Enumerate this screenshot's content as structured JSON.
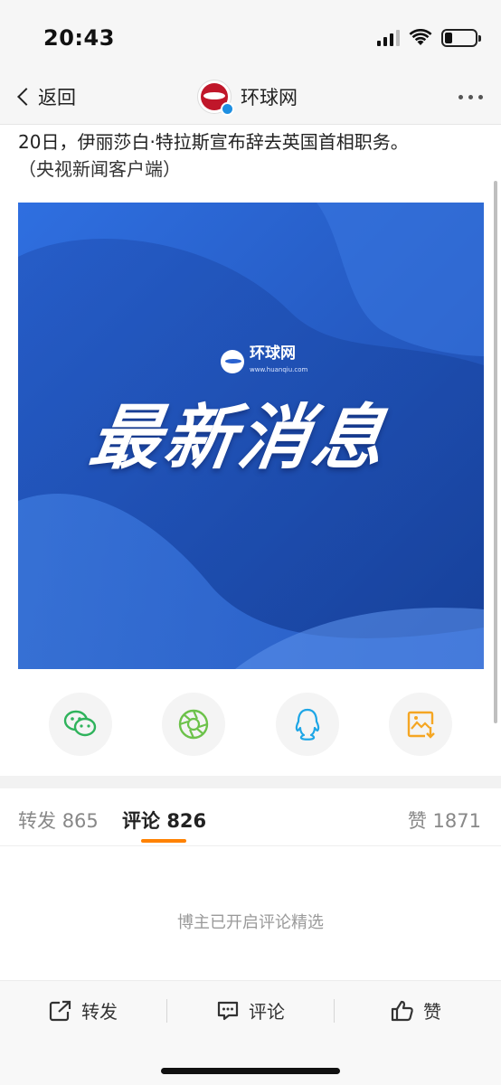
{
  "status_bar": {
    "time": "20:43",
    "battery_level": 0.25
  },
  "nav": {
    "back_label": "返回",
    "account_name": "环球网",
    "more_icon": "more-dots-icon"
  },
  "post": {
    "line1": "20日，伊丽莎白·特拉斯宣布辞去英国首相职务。",
    "line2": "（央视新闻客户端）"
  },
  "news_card": {
    "logo_text": "环球网",
    "logo_sub": "www.huanqiu.com",
    "headline": "最新消息",
    "colors": {
      "primary": "#2a62d0",
      "dark": "#1a4aa8",
      "light": "#3f7be0"
    }
  },
  "share": {
    "icons": [
      "wechat-icon",
      "moments-icon",
      "qq-icon",
      "save-image-icon"
    ]
  },
  "tabs": {
    "repost_label": "转发",
    "repost_count": "865",
    "comment_label": "评论",
    "comment_count": "826",
    "like_label": "赞",
    "like_count": "1871",
    "accent": "#ff8200"
  },
  "comments": {
    "empty_note": "博主已开启评论精选"
  },
  "bottom_bar": {
    "repost": "转发",
    "comment": "评论",
    "like": "赞"
  }
}
